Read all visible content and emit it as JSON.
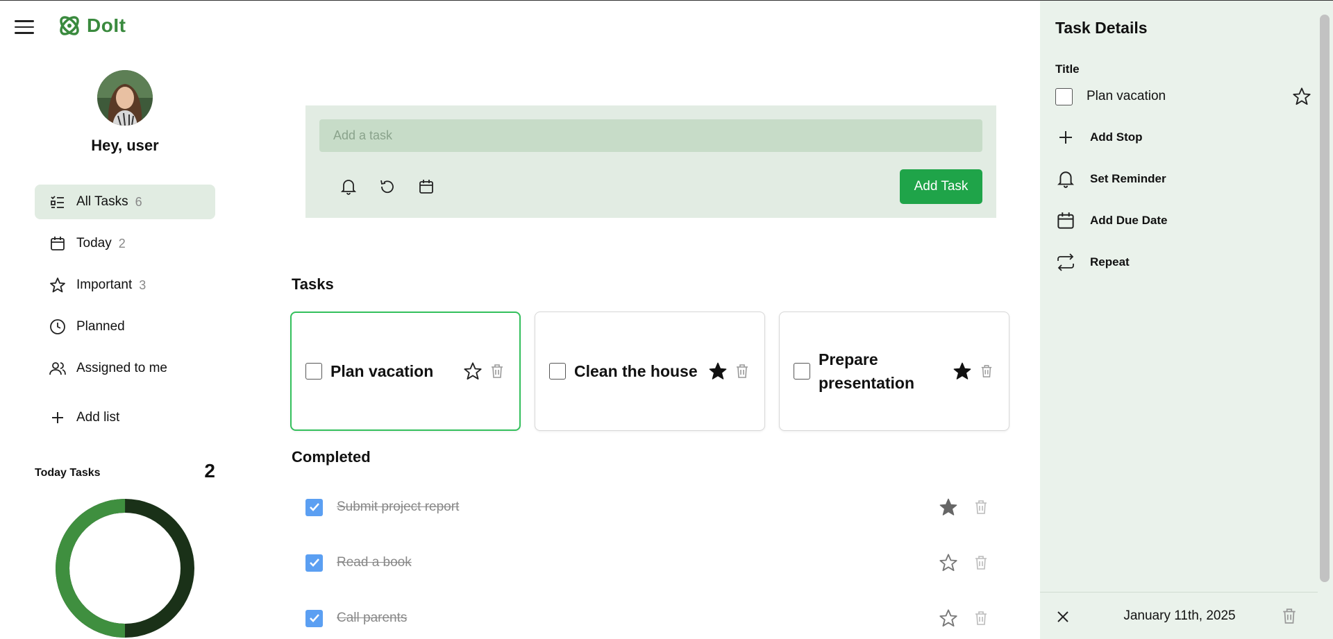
{
  "app": {
    "name": "DoIt"
  },
  "user": {
    "greeting": "Hey, user"
  },
  "sidebar": {
    "items": [
      {
        "label": "All Tasks",
        "count": "6",
        "icon": "list-icon",
        "active": true
      },
      {
        "label": "Today",
        "count": "2",
        "icon": "calendar-icon"
      },
      {
        "label": "Important",
        "count": "3",
        "icon": "star-icon"
      },
      {
        "label": "Planned",
        "count": "",
        "icon": "clock-icon"
      },
      {
        "label": "Assigned to me",
        "count": "",
        "icon": "users-icon"
      }
    ],
    "add_list": "Add list"
  },
  "today_tasks": {
    "label": "Today Tasks",
    "count": "2",
    "completed_fraction": 0.5
  },
  "add_task": {
    "placeholder": "Add a task",
    "button": "Add Task"
  },
  "sections": {
    "tasks": "Tasks",
    "completed": "Completed"
  },
  "tasks": [
    {
      "title": "Plan vacation",
      "important": false,
      "selected": true
    },
    {
      "title": "Clean the house",
      "important": true
    },
    {
      "title": "Prepare presentation",
      "important": true
    }
  ],
  "completed": [
    {
      "title": "Submit project report",
      "important": true
    },
    {
      "title": "Read a book",
      "important": false
    },
    {
      "title": "Call parents",
      "important": false
    }
  ],
  "details": {
    "heading": "Task Details",
    "title_label": "Title",
    "task_title": "Plan vacation",
    "actions": [
      "Add Stop",
      "Set Reminder",
      "Add Due Date",
      "Repeat"
    ],
    "date": "January 11th, 2025"
  },
  "colors": {
    "brand": "#3a8a3e",
    "accent_button": "#1fa449",
    "panel_bg": "#e2ece3",
    "selected_border": "#33c05c",
    "checked_blue": "#5b9ff2"
  }
}
